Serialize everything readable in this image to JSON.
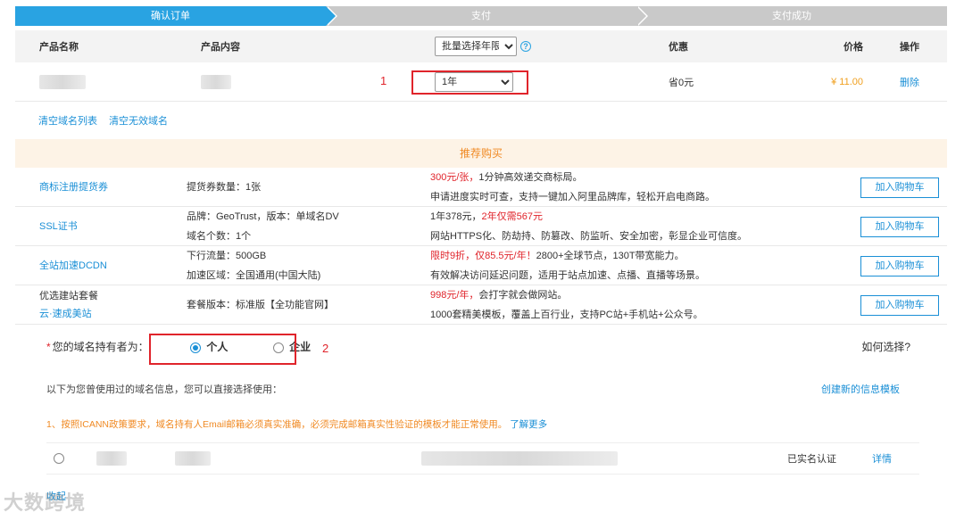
{
  "steps": [
    "确认订单",
    "支付",
    "支付成功"
  ],
  "table": {
    "headers": {
      "name": "产品名称",
      "content": "产品内容",
      "period_select": "批量选择年限",
      "discount": "优惠",
      "price": "价格",
      "action": "操作"
    },
    "row": {
      "period": "1年",
      "discount": "省0元",
      "price": "¥ 11.00",
      "delete": "删除"
    }
  },
  "annotations": {
    "one": "1",
    "two": "2"
  },
  "clear_links": [
    "清空域名列表",
    "清空无效域名"
  ],
  "recommend": {
    "title": "推荐购买",
    "cart_label": "加入购物车",
    "items": [
      {
        "name": "商标注册提货券",
        "spec1": "提货券数量：1张",
        "spec2": "",
        "d1_red": "300元/张，",
        "d1_rest": "1分钟高效递交商标局。",
        "d2_red": "",
        "d2_rest": "申请进度实时可查，支持一键加入阿里品牌库，轻松开启电商路。"
      },
      {
        "name": "SSL证书",
        "spec1": "品牌：GeoTrust，版本：单域名DV",
        "spec2": "域名个数：1个",
        "d1_red": "",
        "d1_rest": "1年378元，",
        "d1_red2": "2年仅需567元",
        "d2_red": "",
        "d2_rest": "网站HTTPS化、防劫持、防篡改、防监听、安全加密，彰显企业可信度。"
      },
      {
        "name": "全站加速DCDN",
        "spec1": "下行流量：500GB",
        "spec2": "加速区域：全国通用(中国大陆)",
        "d1_red": "限时9折，仅85.5元/年！",
        "d1_rest": "2800+全球节点，130T带宽能力。",
        "d2_red": "",
        "d2_rest": "有效解决访问延迟问题，适用于站点加速、点播、直播等场景。"
      },
      {
        "name": "优选建站套餐",
        "name_link": "云·速成美站",
        "spec1": "套餐版本：标准版【全功能官网】",
        "spec2": "",
        "d1_red": "998元/年，",
        "d1_rest": "会打字就会做网站。",
        "d2_red": "",
        "d2_rest": "1000套精美模板，覆盖上百行业，支持PC站+手机站+公众号。"
      }
    ]
  },
  "holder": {
    "star": "*",
    "label": "您的域名持有者为：",
    "option_personal": "个人",
    "option_company": "企业",
    "how": "如何选择?",
    "info": "以下为您曾使用过的域名信息，您可以直接选择使用：",
    "create": "创建新的信息模板",
    "notice": "1、按照ICANN政策要求，域名持有人Email邮箱必须真实准确，必须完成邮箱真实性验证的模板才能正常使用。",
    "learn_more": "了解更多",
    "status": "已实名认证",
    "detail": "详情",
    "collapse": "收起"
  },
  "watermark": "大数跨境",
  "colors": {
    "accent": "#29a3e2",
    "link": "#1a8fd6",
    "warn": "#f08a24",
    "red": "#e0242b"
  }
}
